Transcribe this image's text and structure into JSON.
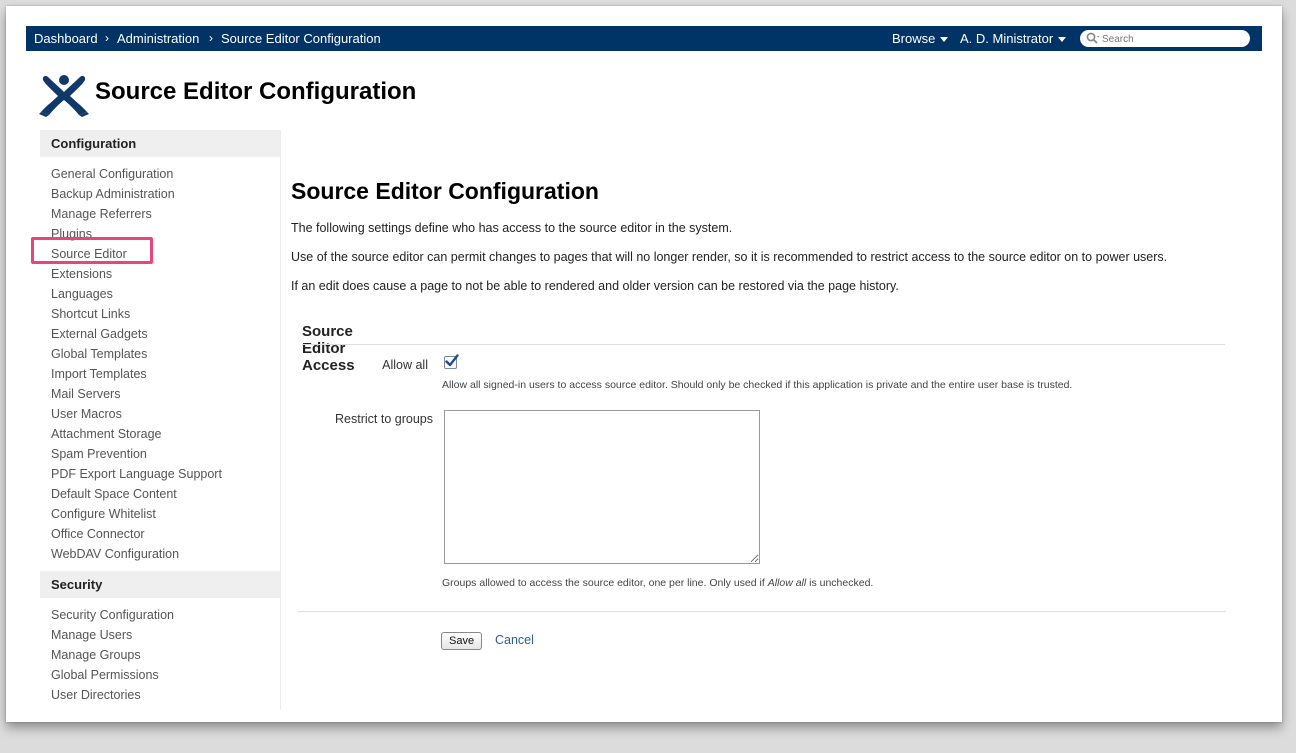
{
  "breadcrumbs": [
    "Dashboard",
    "Administration",
    "Source Editor Configuration"
  ],
  "breadcrumb_separator": "›",
  "nav": {
    "browse_label": "Browse",
    "user_label": "A. D. Ministrator",
    "search_placeholder": "Search"
  },
  "header": {
    "title": "Source Editor Configuration"
  },
  "sidebar": {
    "sections": [
      {
        "title": "Configuration",
        "items": [
          "General Configuration",
          "Backup Administration",
          "Manage Referrers",
          "Plugins",
          "Source Editor",
          "Extensions",
          "Languages",
          "Shortcut Links",
          "External Gadgets",
          "Global Templates",
          "Import Templates",
          "Mail Servers",
          "User Macros",
          "Attachment Storage",
          "Spam Prevention",
          "PDF Export Language Support",
          "Default Space Content",
          "Configure Whitelist",
          "Office Connector",
          "WebDAV Configuration"
        ]
      },
      {
        "title": "Security",
        "items": [
          "Security Configuration",
          "Manage Users",
          "Manage Groups",
          "Global Permissions",
          "User Directories"
        ]
      }
    ],
    "selected_item": "Source Editor"
  },
  "main": {
    "title": "Source Editor Configuration",
    "paragraphs": [
      "The following settings define who has access to the source editor in the system.",
      "Use of the source editor can permit changes to pages that will no longer render, so it is recommended to restrict access to the source editor on to power users.",
      "If an edit does cause a page to not be able to rendered and older version can be restored via the page history."
    ],
    "section_title": "Source Editor Access",
    "allow_all": {
      "label": "Allow all",
      "checked": true,
      "help": "Allow all signed-in users to access source editor. Should only be checked if this application is private and the entire user base is trusted."
    },
    "restrict": {
      "label": "Restrict to groups",
      "value": "",
      "help_before": "Groups allowed to access the source editor, one per line. Only used if ",
      "help_emphasis": "Allow all",
      "help_after": " is unchecked."
    },
    "save_label": "Save",
    "cancel_label": "Cancel"
  },
  "colors": {
    "topbar": "#003366",
    "highlight": "#e8457e",
    "link": "#2a5d9a",
    "checkmark": "#1f4f8c"
  }
}
